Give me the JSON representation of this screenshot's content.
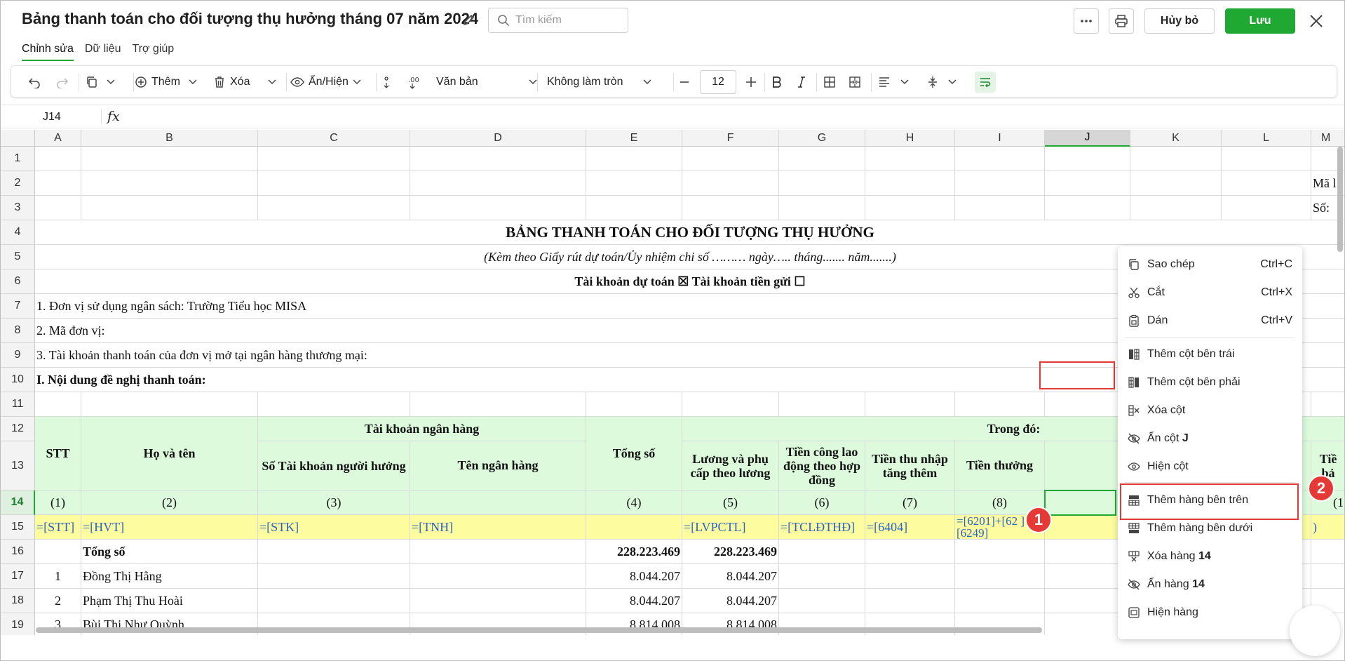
{
  "header": {
    "title": "Bảng thanh toán cho đối tượng thụ hưởng tháng 07 năm 2024",
    "search_placeholder": "Tìm kiếm",
    "cancel_label": "Hủy bỏ",
    "save_label": "Lưu",
    "accent_color": "#1fa832"
  },
  "menu_tabs": [
    "Chỉnh sửa",
    "Dữ liệu",
    "Trợ giúp"
  ],
  "toolbar": {
    "insert_label": "Thêm",
    "delete_label": "Xóa",
    "showhide_label": "Ẩn/Hiện",
    "format_label": "Văn bản",
    "rounding_label": "Không làm tròn",
    "font_size": "12"
  },
  "formula_bar": {
    "cell_ref": "J14",
    "fx_label": "fx"
  },
  "columns": [
    "A",
    "B",
    "C",
    "D",
    "E",
    "F",
    "G",
    "H",
    "I",
    "J",
    "K",
    "L",
    "M"
  ],
  "rows": [
    "1",
    "2",
    "3",
    "4",
    "5",
    "6",
    "7",
    "8",
    "9",
    "10",
    "11",
    "12",
    "13",
    "14",
    "15",
    "16",
    "17",
    "18",
    "19"
  ],
  "sheet": {
    "r2_m": "Mã l",
    "r3_m": "Số:",
    "title": "BẢNG THANH TOÁN CHO ĐỐI TƯỢNG THỤ HƯỞNG",
    "subtitle": "(Kèm theo Giấy rút dự toán/Ủy nhiệm chi số ……… ngày….. tháng....... năm.......)",
    "account_line": "Tài khoản dự toán ☒   Tài khoản tiền gửi ☐",
    "line7": "1. Đơn vị sử dụng ngân sách: Trường Tiểu học MISA",
    "line8": "2. Mã đơn vị:",
    "line9": "3. Tài khoản thanh toán của đơn vị mở tại ngân hàng thương mại:",
    "line10": "I. Nội dung đề nghị thanh toán:",
    "h_stt": "STT",
    "h_name": "Họ và tên",
    "h_bank": "Tài khoản ngân hàng",
    "h_total": "Tổng số",
    "h_among": "Trong đó:",
    "h_acct_no": "Số Tài khoản người hưởng",
    "h_bank_name": "Tên ngân hàng",
    "h_salary": "Lương và phụ cấp theo lương",
    "h_contract": "Tiền công lao động theo hợp đồng",
    "h_extra": "Tiền thu nhập tăng thêm",
    "h_bonus": "Tiền thưởng",
    "h_m13": "Tiề bả",
    "n1": "(1)",
    "n2": "(2)",
    "n3": "(3)",
    "n4": "(4)",
    "n5": "(5)",
    "n6": "(6)",
    "n7": "(7)",
    "n8": "(8)",
    "n_m": "(1",
    "f_stt": "=[STT]",
    "f_hvt": "=[HVT]",
    "f_stk": "=[STK]",
    "f_tnh": "=[TNH]",
    "f_lvpctl": "=[LVPCTL]",
    "f_tcldthd": "=[TCLĐTHĐ]",
    "f_6404": "=[6404]",
    "f_bonus": "=[6201]+[62 ]+[6249]",
    "f_m": ")",
    "total_label": "Tổng số",
    "total_e": "228.223.469",
    "total_f": "228.223.469",
    "r17_stt": "1",
    "r17_name": "Đồng Thị Hằng",
    "r17_e": "8.044.207",
    "r17_f": "8.044.207",
    "r18_stt": "2",
    "r18_name": "Phạm Thị Thu Hoài",
    "r18_e": "8.044.207",
    "r18_f": "8.044.207",
    "r19_stt": "3",
    "r19_name": "Bùi Thị Như Quỳnh",
    "r19_e": "8.814.008",
    "r19_f": "8.814.008"
  },
  "context_menu": {
    "copy": "Sao chép",
    "copy_sc": "Ctrl+C",
    "cut": "Cắt",
    "cut_sc": "Ctrl+X",
    "paste": "Dán",
    "paste_sc": "Ctrl+V",
    "insert_col_left": "Thêm cột bên trái",
    "insert_col_right": "Thêm cột bên phải",
    "delete_col": "Xóa cột",
    "hide_col": "Ẩn cột",
    "hide_col_ref": "J",
    "show_col": "Hiện cột",
    "insert_row_above": "Thêm hàng bên trên",
    "insert_row_below": "Thêm hàng bên dưới",
    "delete_row": "Xóa hàng",
    "delete_row_ref": "14",
    "hide_row": "Ẩn hàng",
    "hide_row_ref": "14",
    "show_row": "Hiện hàng"
  },
  "annotations": {
    "badge1": "1",
    "badge2": "2",
    "highlight_color": "#e53935"
  }
}
